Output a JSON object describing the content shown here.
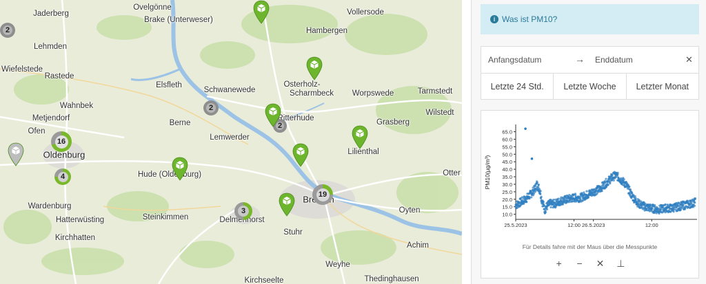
{
  "map": {
    "places": [
      {
        "name": "Jaderberg"
      },
      {
        "name": "Ovelgönne"
      },
      {
        "name": "Brake (Unterweser)"
      },
      {
        "name": "Vollersode"
      },
      {
        "name": "Hambergen"
      },
      {
        "name": "Lehmden"
      },
      {
        "name": "Wiefelstede"
      },
      {
        "name": "Rastede"
      },
      {
        "name": "Elsfleth"
      },
      {
        "name": "Schwanewede"
      },
      {
        "name": "Osterholz-"
      },
      {
        "name": "Scharmbeck"
      },
      {
        "name": "Worpswede"
      },
      {
        "name": "Tarmstedt"
      },
      {
        "name": "Wahnbek"
      },
      {
        "name": "Metjendorf"
      },
      {
        "name": "Wilstedt"
      },
      {
        "name": "Berne"
      },
      {
        "name": "Ritterhude"
      },
      {
        "name": "Grasberg"
      },
      {
        "name": "Ofen"
      },
      {
        "name": "Lemwerder"
      },
      {
        "name": "Lilienthal"
      },
      {
        "name": "Oldenburg"
      },
      {
        "name": "Hude (Oldenburg)"
      },
      {
        "name": "Otter"
      },
      {
        "name": "Wardenburg"
      },
      {
        "name": "Bremen"
      },
      {
        "name": "Oyten"
      },
      {
        "name": "Hatterwüsting"
      },
      {
        "name": "Steinkimmen"
      },
      {
        "name": "Delmenhorst"
      },
      {
        "name": "Kirchhatten"
      },
      {
        "name": "Stuhr"
      },
      {
        "name": "Achim"
      },
      {
        "name": "Weyhe"
      },
      {
        "name": "Kirchseelte"
      },
      {
        "name": "Thedinghausen"
      }
    ],
    "clusters": [
      {
        "count": "2",
        "color": "#8e8e8e",
        "core": "#b5b5b5",
        "green": 0
      },
      {
        "count": "2",
        "color": "#8e8e8e",
        "core": "#b5b5b5",
        "green": 0
      },
      {
        "count": "2",
        "color": "#8e8e8e",
        "core": "#b5b5b5",
        "green": 0
      },
      {
        "count": "16",
        "color": "#78b82a",
        "core": "#e0e0e0",
        "green": 0.7
      },
      {
        "count": "4",
        "color": "#78b82a",
        "core": "#d0d0d0",
        "green": 0.75
      },
      {
        "count": "19",
        "color": "#78b82a",
        "core": "#d9d9d9",
        "green": 0.25
      },
      {
        "count": "3",
        "color": "#78b82a",
        "core": "#c8c8c8",
        "green": 0.5
      }
    ],
    "pins": [
      {
        "color": "#6cb52d"
      },
      {
        "color": "#6cb52d"
      },
      {
        "color": "#6cb52d"
      },
      {
        "color": "#6cb52d"
      },
      {
        "color": "#6cb52d"
      },
      {
        "color": "#6cb52d"
      },
      {
        "color": "#6cb52d"
      },
      {
        "color": "#bdbdbd"
      }
    ]
  },
  "panel": {
    "info_label": "Was ist PM10?",
    "start_placeholder": "Anfangsdatum",
    "arrow": "→",
    "end_placeholder": "Enddatum",
    "clear": "✕",
    "presets": [
      "Letzte 24 Std.",
      "Letzte Woche",
      "Letzter Monat"
    ],
    "hint": "Für Details fahre mit der Maus über die Messpunkte",
    "tools": {
      "zoom_in": "+",
      "zoom_out": "−",
      "reset": "✕",
      "download": "⊥"
    }
  },
  "chart_data": {
    "type": "scatter",
    "ylabel": "PM10(µg/m³)",
    "yticks": [
      10.0,
      15.0,
      20.0,
      25.0,
      30.0,
      35.0,
      40.0,
      45.0,
      50.0,
      55.0,
      60.0,
      65.0
    ],
    "ylim": [
      8,
      68
    ],
    "xticks": [
      "25.5.2023",
      "12:00",
      "26.5.2023",
      "12:00"
    ],
    "color": "#2f7fc1",
    "series": [
      {
        "x_hours": [
          0,
          3,
          6,
          9,
          12,
          13,
          15,
          16,
          18,
          19,
          21,
          24,
          28,
          32,
          36,
          40,
          44,
          48,
          52,
          55,
          58,
          60,
          62,
          64,
          66,
          68,
          72,
          76,
          80,
          84,
          88,
          92,
          96,
          100,
          104,
          108,
          111
        ],
        "values": [
          16,
          18,
          20,
          23,
          27,
          30,
          26,
          20,
          13,
          15,
          17,
          17,
          19,
          20,
          21,
          21,
          23,
          25,
          27,
          30,
          33,
          35,
          36,
          34,
          32,
          30,
          22,
          17,
          15,
          14,
          13,
          14,
          14,
          15,
          16,
          17,
          18
        ]
      }
    ],
    "outliers": [
      {
        "x_hours": 6,
        "value": 67
      },
      {
        "x_hours": 10,
        "value": 47
      }
    ]
  }
}
